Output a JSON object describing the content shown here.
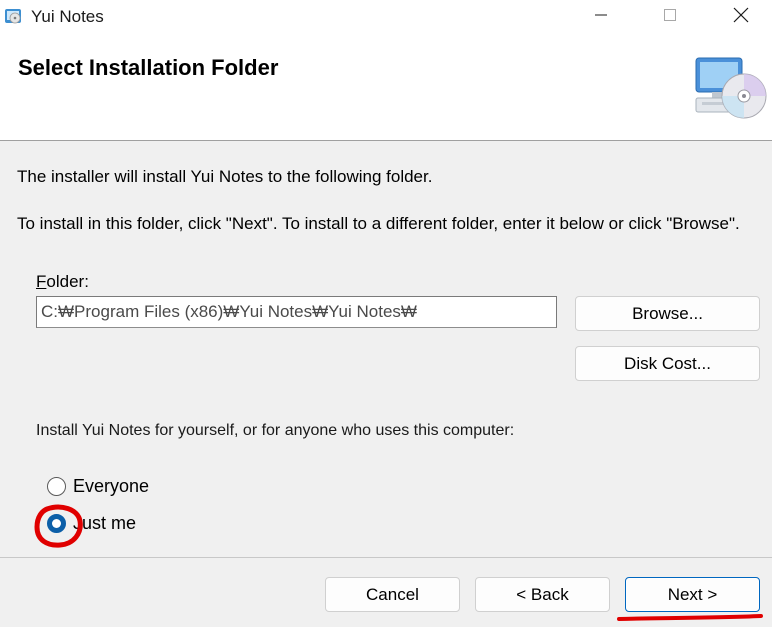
{
  "window": {
    "title": "Yui Notes",
    "app_icon": "setup-cd-icon",
    "controls": {
      "minimize": "minimize-icon",
      "maximize": "maximize-icon",
      "close": "close-icon"
    }
  },
  "header": {
    "title": "Select Installation Folder",
    "icon": "computer-cd-icon"
  },
  "body": {
    "description_line1": "The installer will install Yui Notes to the following folder.",
    "description_line2": "To install in this folder, click \"Next\". To install to a different folder, enter it below or click \"Browse\".",
    "folder_label": "Folder:",
    "folder_value": "C:₩Program Files (x86)₩Yui Notes₩Yui Notes₩",
    "browse_button": "Browse...",
    "disk_cost_button": "Disk Cost...",
    "install_for_label": "Install Yui Notes for yourself, or for anyone who uses this computer:",
    "options": [
      {
        "label": "Everyone",
        "checked": false
      },
      {
        "label": "Just me",
        "checked": true
      }
    ]
  },
  "footer": {
    "cancel_button": "Cancel",
    "back_button": "< Back",
    "next_button": "Next >"
  },
  "annotation_color": "#e00000",
  "accent_color": "#0c5fa8"
}
